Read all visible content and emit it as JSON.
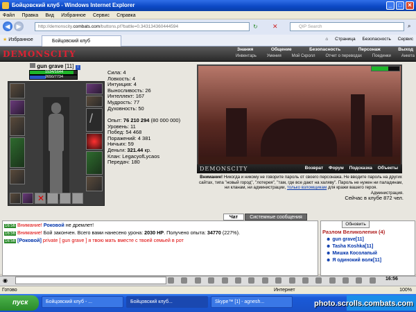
{
  "window": {
    "title": "Бойцовский клуб - Windows Internet Explorer"
  },
  "menu": [
    "Файл",
    "Правка",
    "Вид",
    "Избранное",
    "Сервис",
    "Справка"
  ],
  "address": {
    "prefix": "http://demonscity.",
    "host": "combats.com",
    "path": "/buttons.pl?battle=0.343134360444594"
  },
  "search": {
    "placeholder": "QIP Search"
  },
  "favorites_label": "Избранное",
  "tab_label": "Бойцовский клуб",
  "ie_tools": [
    "Страница",
    "Безопасность",
    "Сервис"
  ],
  "game": {
    "logo": "DEMONSCITY",
    "top_nav": [
      "Знания",
      "Общение",
      "Безопасность",
      "Персонаж",
      "Выход"
    ],
    "sub_nav": [
      "Инвентарь",
      "Умения",
      "Мой Скролл",
      "Отчет о переводах",
      "Поединки",
      "Анкета"
    ],
    "character": {
      "name": "gun grave",
      "level": "[11]",
      "hp": "1534/1644",
      "mp": "2650/7734",
      "hp_fraction": 0.93,
      "mp_fraction": 0.34
    },
    "stats": [
      "Сила: 4",
      "Ловкость: 4",
      "Интуиция: 4",
      "Выносливость: 26",
      "Интеллект: 167",
      "Мудрость: 77",
      "Духовность: 50"
    ],
    "exp_label": "Опыт:",
    "exp_value": "76 210 294",
    "exp_next": "(80 000 000)",
    "details": [
      "Уровень: 11",
      "Побед: 54 468",
      "Поражений: 4 381",
      "Ничьих: 59"
    ],
    "money_label": "Деньги:",
    "money_value": "321.44",
    "money_unit": "кр.",
    "details2": [
      "Клан: LegacyofLycaos",
      "Передач: 180"
    ],
    "scene_brand": "DEMONSCITY",
    "scene_links": [
      "Возврат",
      "Форум",
      "Подсказка",
      "Объекты"
    ],
    "warning_title": "Внимание!",
    "warning_text": "Никогда и никому не говорите пароль от своего персонажа. Не вводите пароль на других сайтах, типа \"новый город\", \"лотерея\", \"там, где все дают на халяву\". Пароль не нужен ни паладинам, ни кланам, ни администрации,",
    "warning_link": "только взломщикам",
    "warning_tail": "для кражи вашего героя.",
    "warning_sign": "Администрация.",
    "online_now": "Сейчас в клубе 872 чел."
  },
  "chat": {
    "tab_chat": "Чат",
    "tab_system": "Системные сообщения",
    "lines": [
      {
        "time": "16:56",
        "parts": [
          [
            "red",
            "Внимание!"
          ],
          [
            "plain",
            " "
          ],
          [
            "blue",
            "Роковой"
          ],
          [
            "plain",
            " не дремлет!"
          ]
        ]
      },
      {
        "time": "16:56",
        "parts": [
          [
            "red",
            "Внимание!"
          ],
          [
            "plain",
            " Бой закончен. Всего вами нанесено урона: "
          ],
          [
            "bold",
            "2030 HP"
          ],
          [
            "plain",
            ". Получено опыта: "
          ],
          [
            "bold",
            "34770"
          ],
          [
            "plain",
            " (227%)."
          ]
        ]
      },
      {
        "time": "16:56",
        "parts": [
          [
            "blue",
            "[Роковой]"
          ],
          [
            "plain",
            " "
          ],
          [
            "red",
            "private [ gun grave ]"
          ],
          [
            "plain",
            " "
          ],
          [
            "red",
            "я твою мать вместе с твоей семьей в рот"
          ]
        ]
      }
    ]
  },
  "online": {
    "refresh": "Обновить",
    "room": "Разлом Великолепия (4)",
    "users": [
      "gun grave[11]",
      "Tasha Koshka[11]",
      "Мишка Косолапый",
      "Я одинокий волк[11]"
    ]
  },
  "clock": "16:56",
  "status": {
    "left": "Готово",
    "zone": "Интернет",
    "zoom": "100%"
  },
  "taskbar": {
    "start": "пуск",
    "tasks": [
      "Бойцовский клуб - ...",
      "Бойцовский клуб...",
      "Skype™ [1] - agnesh..."
    ]
  },
  "watermark": "photo.scrolls.combats.com"
}
